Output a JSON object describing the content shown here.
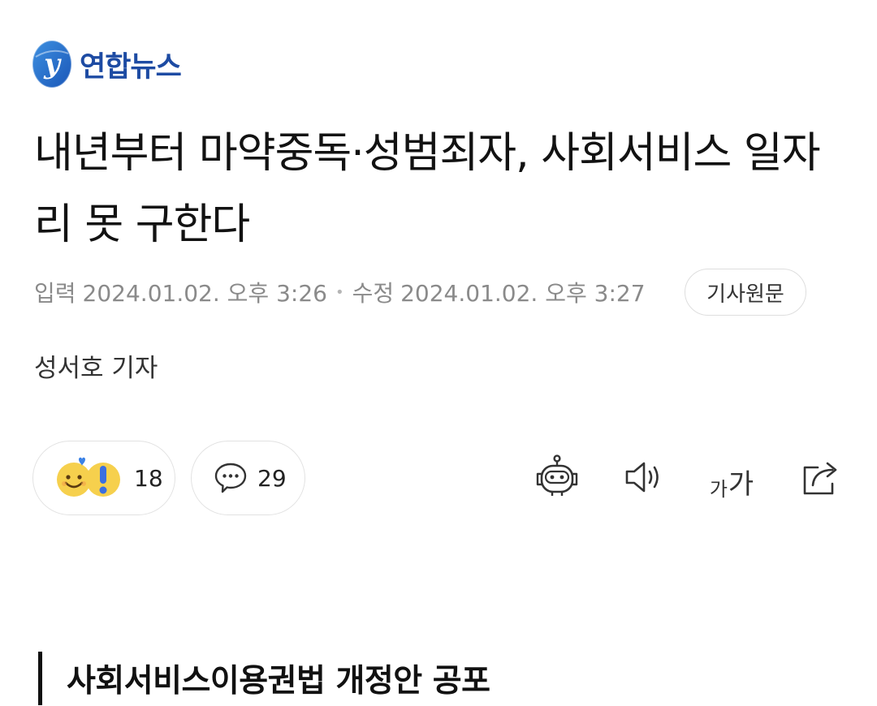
{
  "publisher": {
    "name": "연합뉴스",
    "logo_letter": "y",
    "brand_color": "#1d4ba3"
  },
  "article": {
    "headline": "내년부터 마약중독·성범죄자, 사회서비스 일자리 못 구한다",
    "input_label": "입력",
    "input_time": "2024.01.02. 오후 3:26",
    "separator": "•",
    "modified_label": "수정",
    "modified_time": "2024.01.02. 오후 3:27",
    "original_button": "기사원문",
    "reporter": "성서호 기자",
    "section_title": "사회서비스이용권법 개정안 공포"
  },
  "reactions": {
    "count": "18",
    "icons": [
      "smiley-face-icon",
      "exclamation-icon"
    ]
  },
  "comments": {
    "count": "29",
    "icon": "speech-bubble-icon"
  },
  "tools": {
    "ai_summary_icon": "robot-icon",
    "tts_icon": "speaker-icon",
    "font_small": "가",
    "font_large": "가",
    "share_icon": "share-icon"
  }
}
